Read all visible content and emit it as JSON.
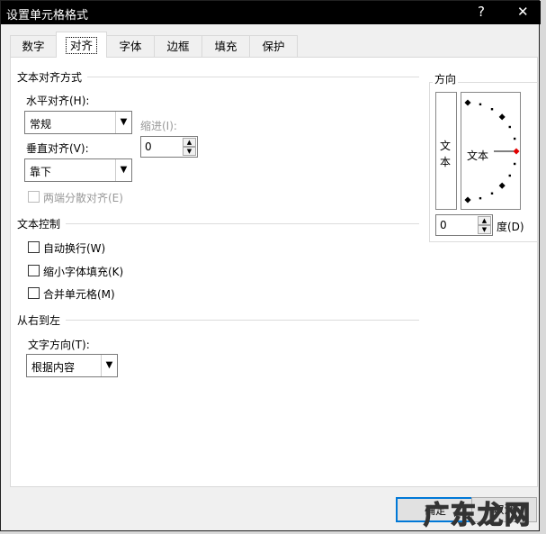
{
  "title": "设置单元格格式",
  "help_label": "?",
  "close_label": "✕",
  "tabs": [
    {
      "label": "数字"
    },
    {
      "label": "对齐"
    },
    {
      "label": "字体"
    },
    {
      "label": "边框"
    },
    {
      "label": "填充"
    },
    {
      "label": "保护"
    }
  ],
  "text_align": {
    "heading": "文本对齐方式",
    "horizontal_label": "水平对齐(H):",
    "horizontal_value": "常规",
    "indent_label": "缩进(I):",
    "indent_value": "0",
    "vertical_label": "垂直对齐(V):",
    "vertical_value": "靠下",
    "distributed_label": "两端分散对齐(E)"
  },
  "text_control": {
    "heading": "文本控制",
    "wrap": "自动换行(W)",
    "shrink": "缩小字体填充(K)",
    "merge": "合并单元格(M)"
  },
  "rtl": {
    "heading": "从右到左",
    "direction_label": "文字方向(T):",
    "direction_value": "根据内容"
  },
  "orientation": {
    "heading": "方向",
    "vertical_text": "文本",
    "dial_text": "文本",
    "degrees_value": "0",
    "degrees_label": "度(D)",
    "accent": "#e00000"
  },
  "buttons": {
    "ok": "确定",
    "cancel": "取消"
  },
  "watermark": "广东龙网"
}
